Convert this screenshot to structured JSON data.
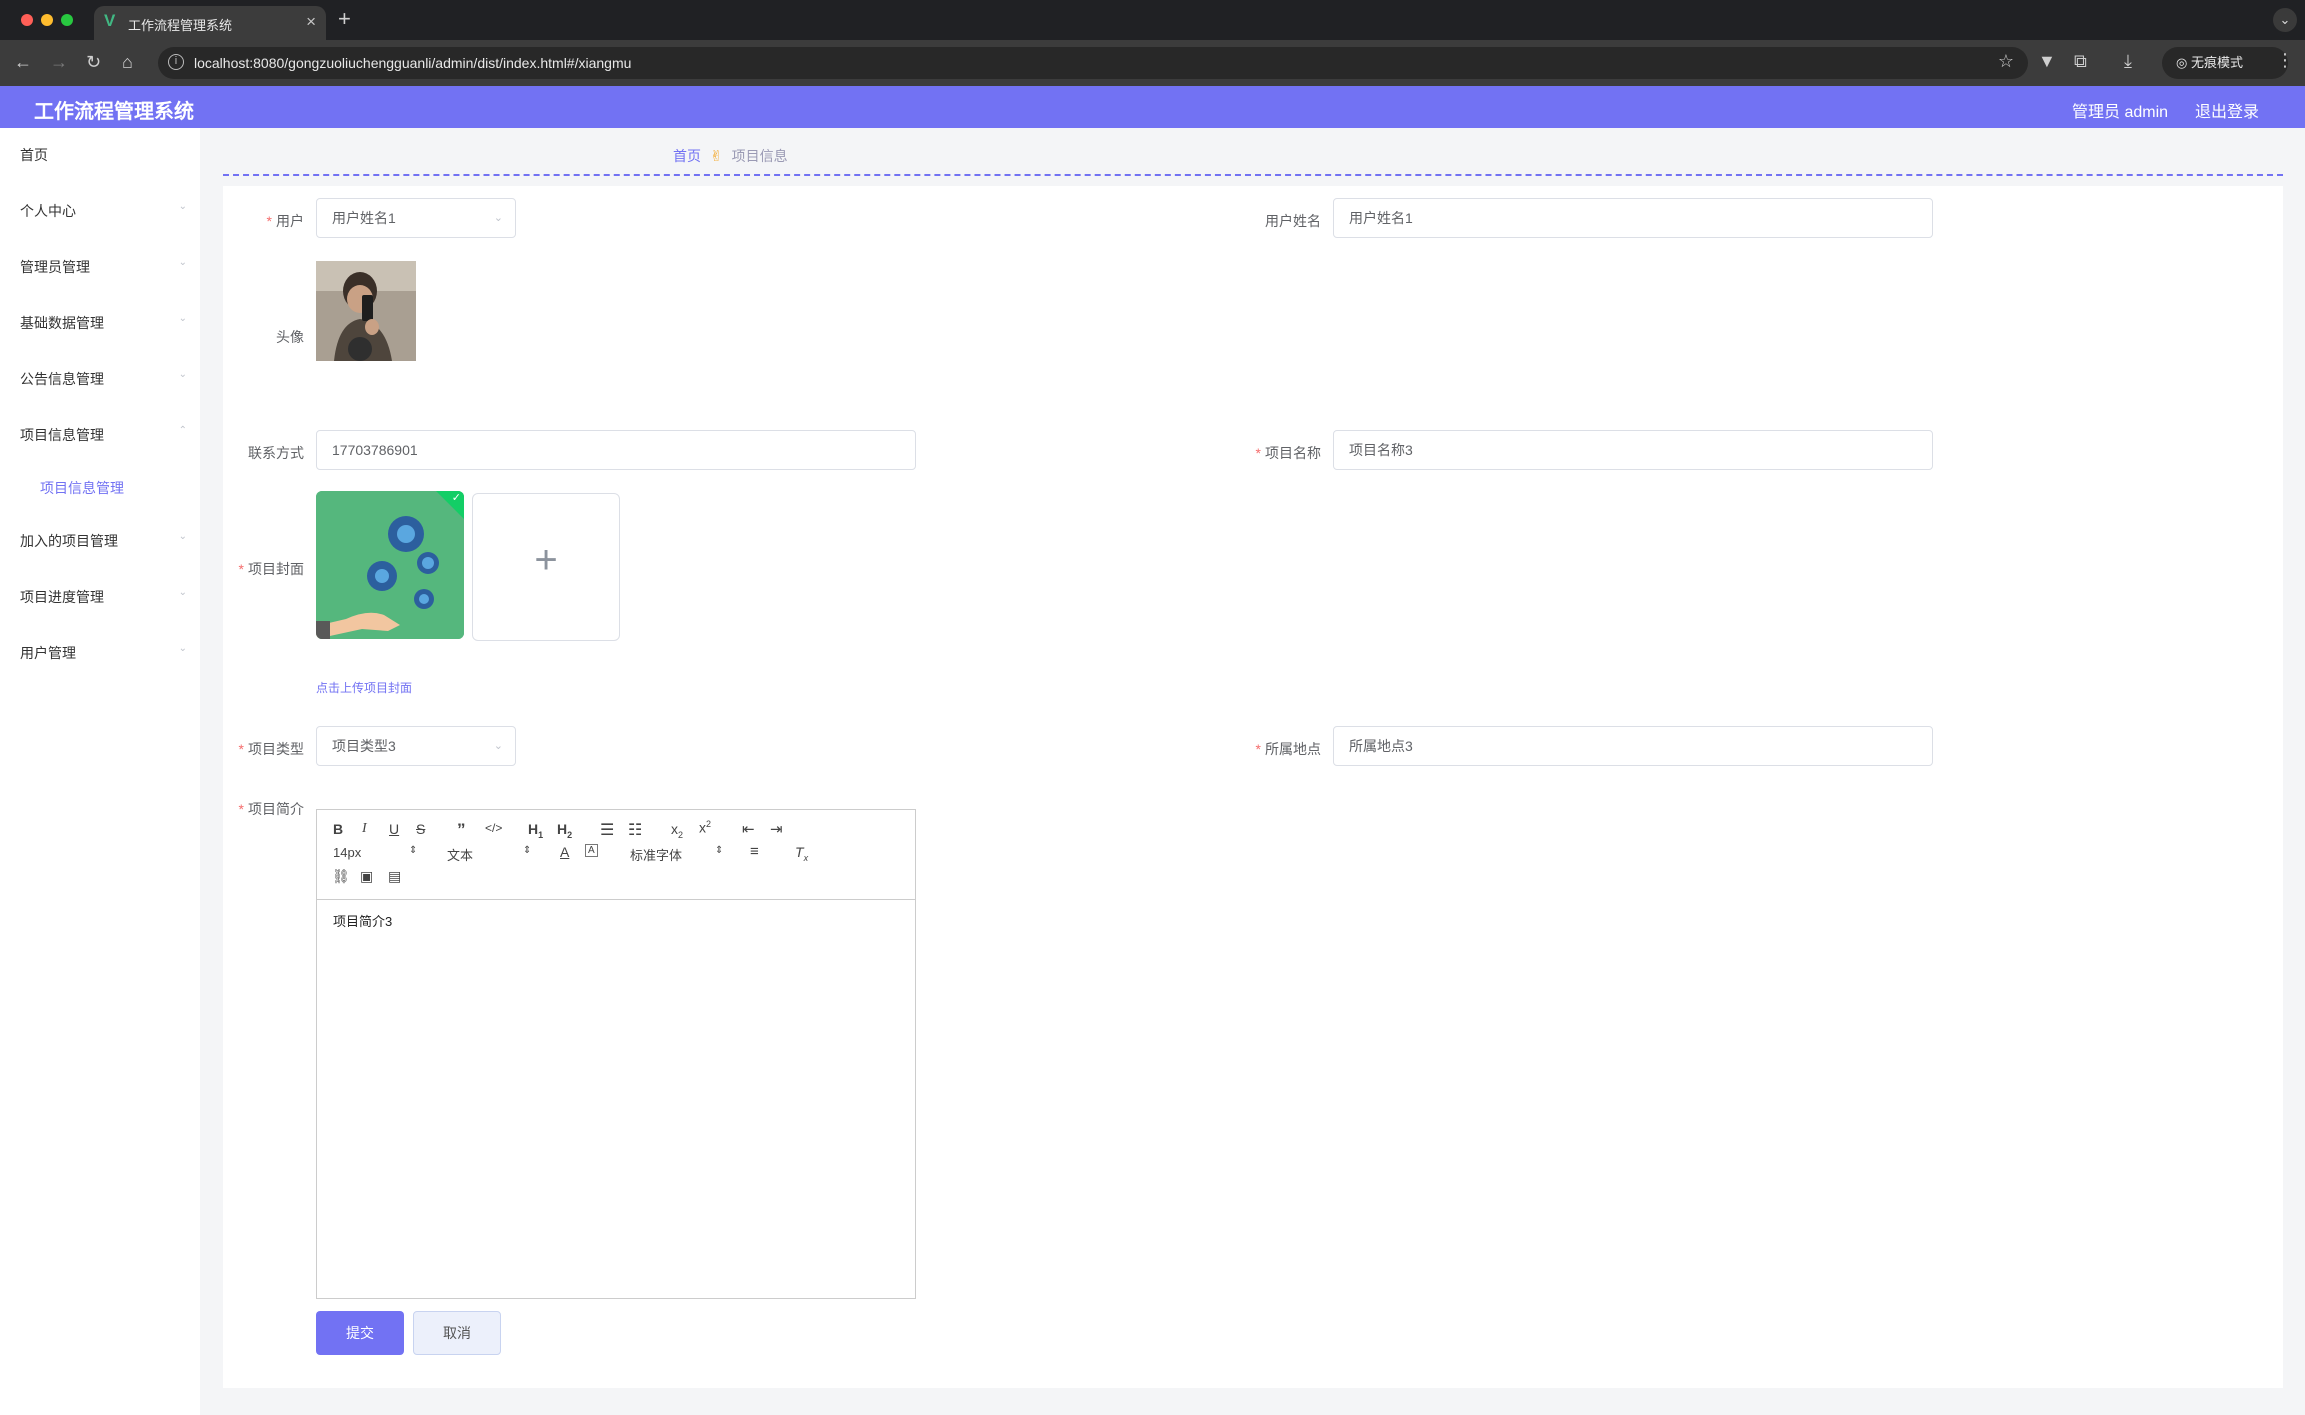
{
  "browser": {
    "tab_title": "工作流程管理系统",
    "url": "localhost:8080/gongzuoliuchengguanli/admin/dist/index.html#/xiangmu",
    "incognito_label": "无痕模式"
  },
  "header": {
    "app_title": "工作流程管理系统",
    "user": "管理员 admin",
    "logout": "退出登录"
  },
  "sidebar": {
    "items": [
      {
        "label": "首页"
      },
      {
        "label": "个人中心"
      },
      {
        "label": "管理员管理"
      },
      {
        "label": "基础数据管理"
      },
      {
        "label": "公告信息管理"
      },
      {
        "label": "项目信息管理"
      },
      {
        "label": "加入的项目管理"
      },
      {
        "label": "项目进度管理"
      },
      {
        "label": "用户管理"
      }
    ],
    "active_sub": "项目信息管理"
  },
  "breadcrumb": {
    "home": "首页",
    "current": "项目信息"
  },
  "form": {
    "user_label": "用户",
    "user_value": "用户姓名1",
    "username_label": "用户姓名",
    "username_value": "用户姓名1",
    "avatar_label": "头像",
    "contact_label": "联系方式",
    "contact_value": "17703786901",
    "project_name_label": "项目名称",
    "project_name_value": "项目名称3",
    "cover_label": "项目封面",
    "upload_tip": "点击上传项目封面",
    "type_label": "项目类型",
    "type_value": "项目类型3",
    "location_label": "所属地点",
    "location_value": "所属地点3",
    "intro_label": "项目简介",
    "intro_value": "项目简介3",
    "submit": "提交",
    "cancel": "取消"
  },
  "editor_toolbar": {
    "font_size": "14px",
    "heading": "文本",
    "font_family": "标准字体"
  },
  "colors": {
    "accent": "#7272f3",
    "required": "#f56c6c",
    "success": "#13ce66"
  }
}
